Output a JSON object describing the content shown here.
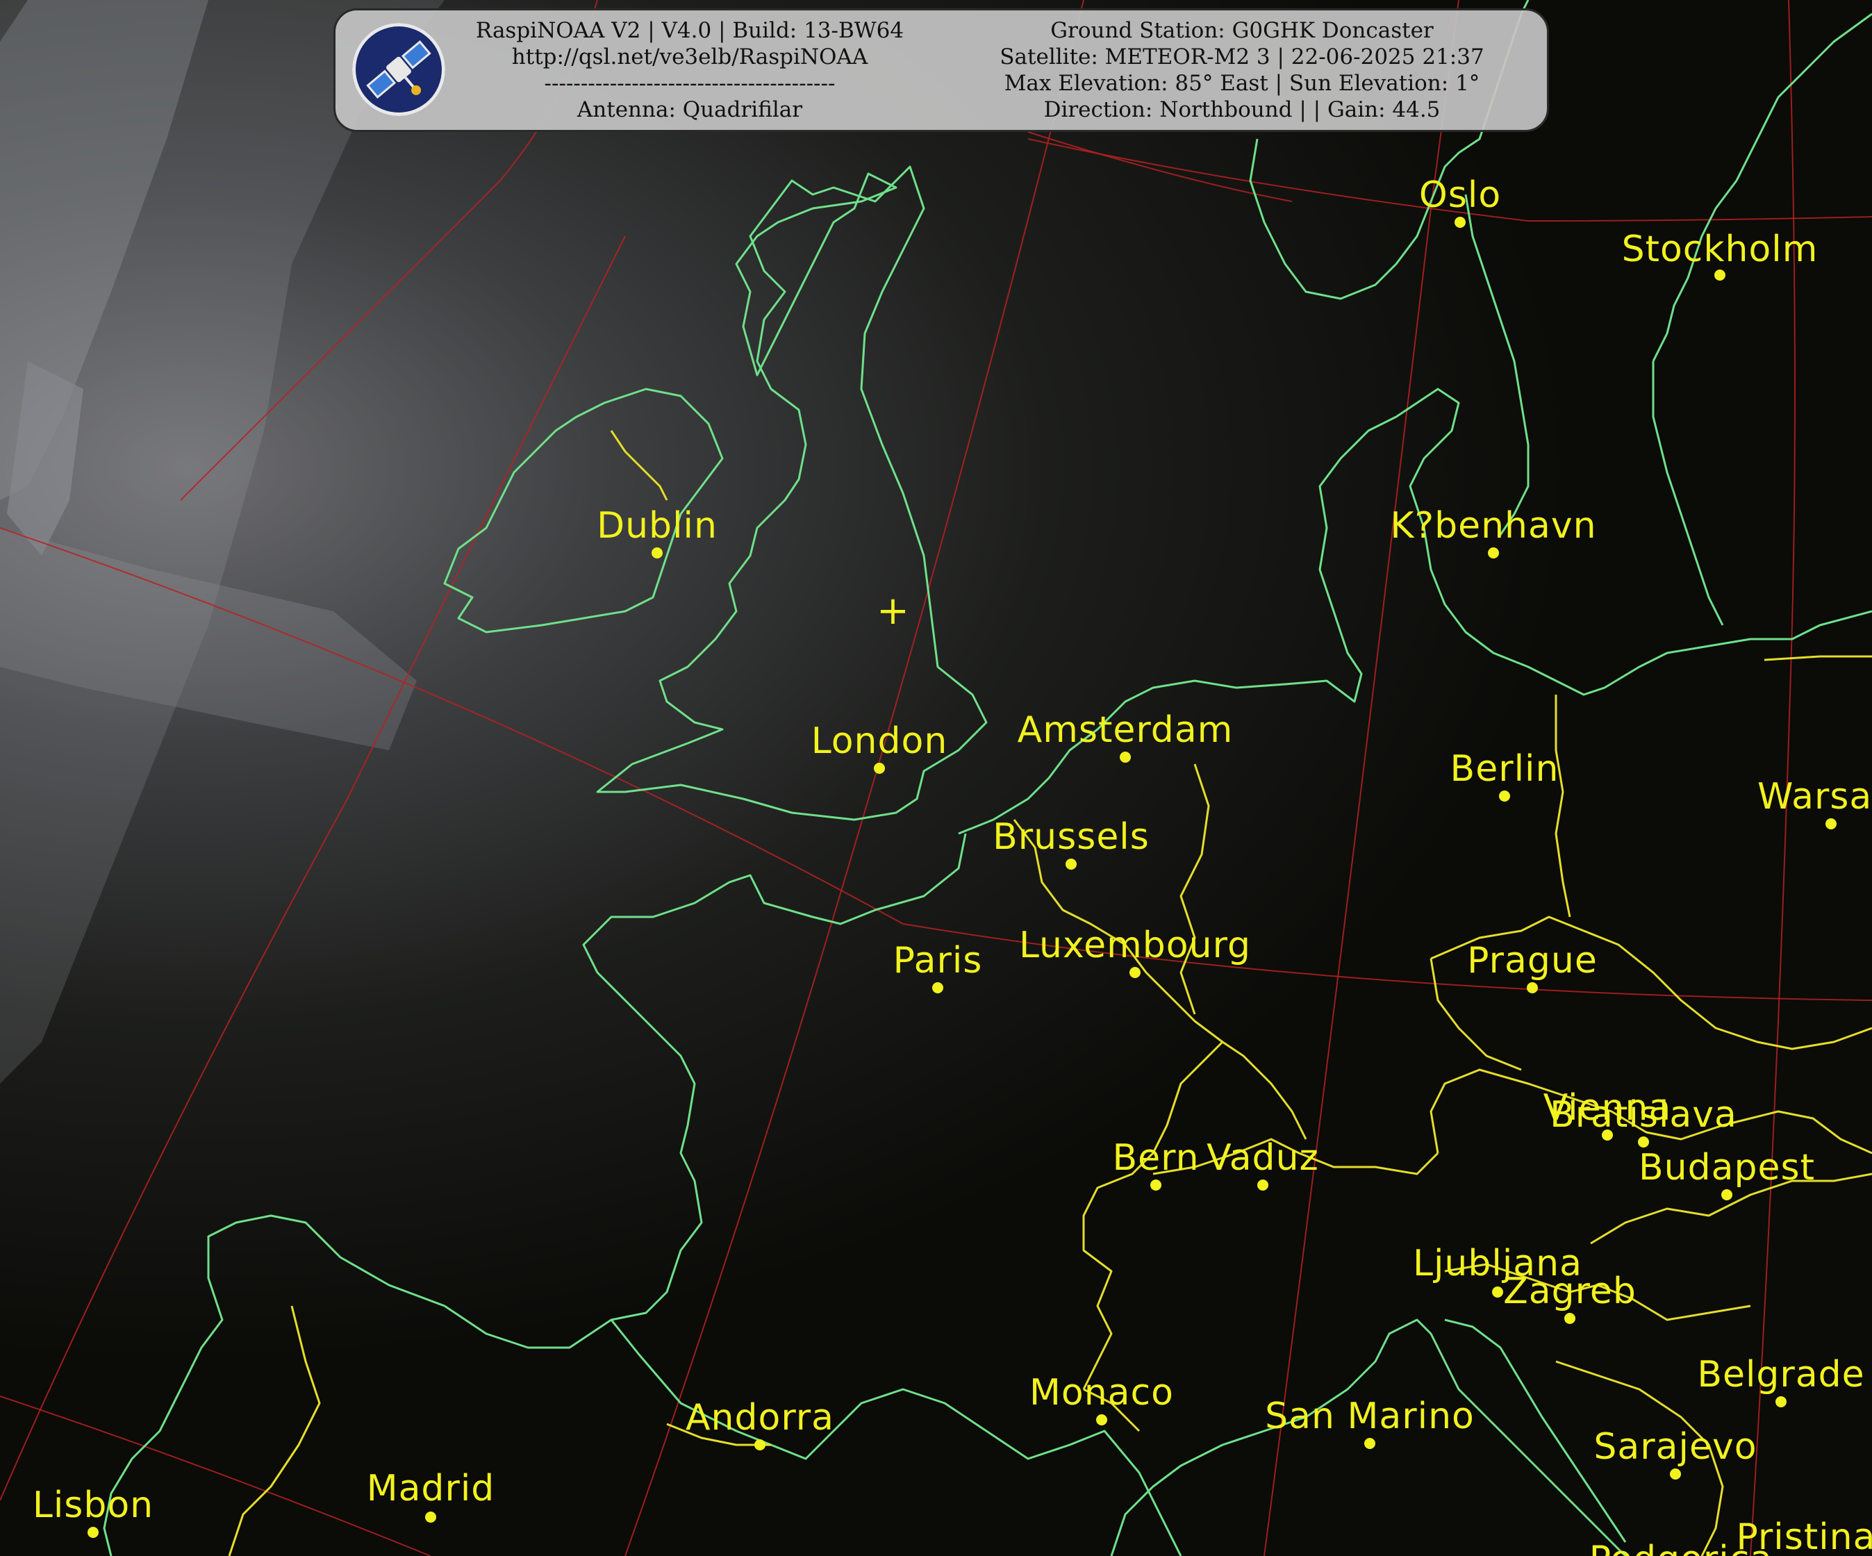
{
  "info_panel": {
    "left_lines": [
      "RaspiNOAA V2 | V4.0 | Build: 13-BW64",
      "http://qsl.net/ve3elb/RaspiNOAA",
      "----------------------------------------",
      "Antenna: Quadrifilar"
    ],
    "right_lines": [
      "Ground Station: G0GHK Doncaster",
      "Satellite: METEOR-M2 3 | 22-06-2025 21:37",
      "Max Elevation: 85° East | Sun Elevation: 1°",
      "Direction: Northbound | | Gain: 44.5"
    ],
    "logo_icon": "satellite-icon"
  },
  "colors": {
    "city_label": "#f2f21f",
    "coastline": "#6fe08a",
    "border": "#e4de2a",
    "graticule": "#b52222",
    "panel_bg": "#c4c4c4"
  },
  "station_marker": "+",
  "cities": [
    {
      "name": "Oslo"
    },
    {
      "name": "Stockholm"
    },
    {
      "name": "Dublin"
    },
    {
      "name": "K?benhavn"
    },
    {
      "name": "London"
    },
    {
      "name": "Amsterdam"
    },
    {
      "name": "Berlin"
    },
    {
      "name": "Warsa"
    },
    {
      "name": "Brussels"
    },
    {
      "name": "Luxembourg"
    },
    {
      "name": "Paris"
    },
    {
      "name": "Prague"
    },
    {
      "name": "Vienna"
    },
    {
      "name": "Bratislava"
    },
    {
      "name": "Budapest"
    },
    {
      "name": "Bern"
    },
    {
      "name": "Vaduz"
    },
    {
      "name": "Ljubljana"
    },
    {
      "name": "Zagreb"
    },
    {
      "name": "Monaco"
    },
    {
      "name": "San Marino"
    },
    {
      "name": "Belgrade"
    },
    {
      "name": "Andorra"
    },
    {
      "name": "Sarajevo"
    },
    {
      "name": "Madrid"
    },
    {
      "name": "Lisbon"
    },
    {
      "name": "Pristina"
    },
    {
      "name": "Podgorica"
    }
  ]
}
